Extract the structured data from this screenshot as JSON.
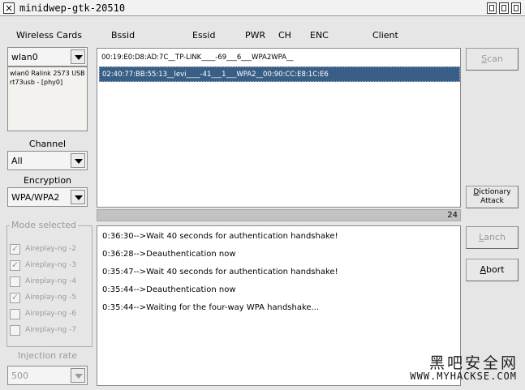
{
  "window": {
    "title": "minidwep-gtk-20510"
  },
  "headers": {
    "wireless_cards": "Wireless Cards",
    "bssid": "Bssid",
    "essid": "Essid",
    "pwr": "PWR",
    "ch": "CH",
    "enc": "ENC",
    "client": "Client"
  },
  "left": {
    "card_value": "wlan0",
    "card_info": "wlan0 Ralink 2573 USB rt73usb - [phy0]",
    "channel_label": "Channel",
    "channel_value": "All",
    "encryption_label": "Encryption",
    "encryption_value": "WPA/WPA2",
    "mode_label": "Mode selected",
    "modes": [
      {
        "label": "Aireplay-ng -2",
        "checked": true
      },
      {
        "label": "Aireplay-ng -3",
        "checked": true
      },
      {
        "label": "Aireplay-ng -4",
        "checked": false
      },
      {
        "label": "Aireplay-ng -5",
        "checked": true
      },
      {
        "label": "Aireplay-ng -6",
        "checked": false
      },
      {
        "label": "Aireplay-ng -7",
        "checked": false
      }
    ],
    "injection_label": "Injection rate",
    "injection_value": "500"
  },
  "networks": [
    "00:19:E0:D8:AD:7C__TP-LINK____-69___6___WPA2WPA__",
    "02:40:77:BB:55:13__levi____-41___1___WPA2__00:90:CC:E8:1C:E6"
  ],
  "progress": {
    "value": "24"
  },
  "log": [
    "0:36:30-->Wait 40 seconds for authentication handshake!",
    "0:36:28-->Deauthentication now",
    "0:35:47-->Wait 40 seconds for authentication handshake!",
    "0:35:44-->Deauthentication now",
    "0:35:44-->Waiting for the four-way WPA handshake..."
  ],
  "buttons": {
    "scan_u": "S",
    "scan_rest": "can",
    "dict_u": "D",
    "dict_rest": "ictionary",
    "dict_line2": "Attack",
    "lanch_u": "L",
    "lanch_rest": "anch",
    "abort_u": "A",
    "abort_rest": "bort"
  },
  "watermark": {
    "cn": "黑吧安全网",
    "url": "WWW.MYHACKSE.COM"
  }
}
